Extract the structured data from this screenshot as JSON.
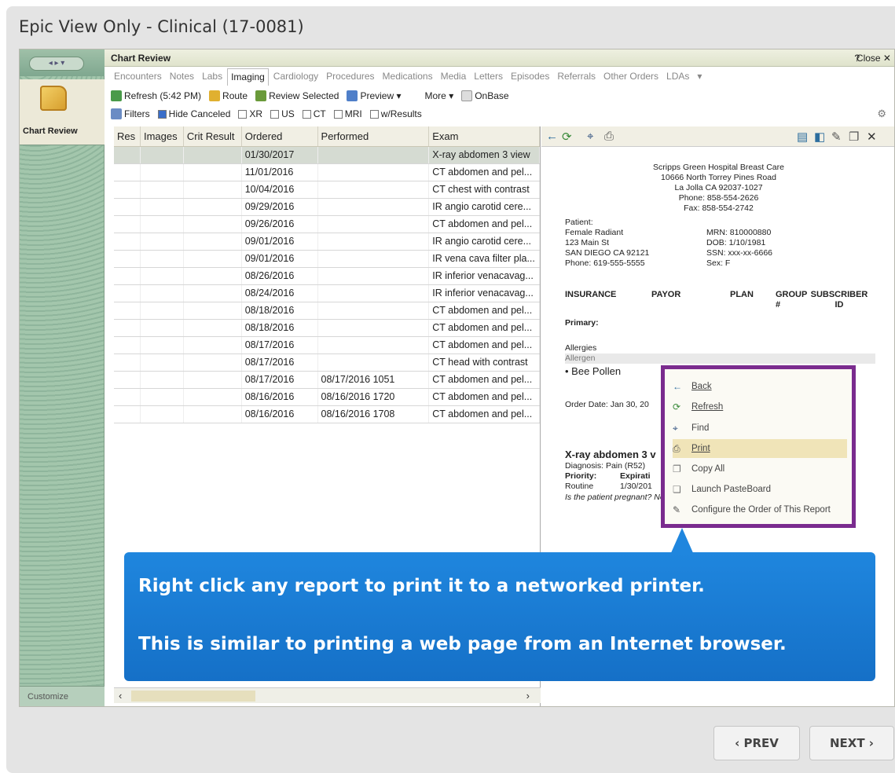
{
  "frame": {
    "title": "Epic View Only - Clinical (17-0081)"
  },
  "rail": {
    "nav_label": "◂ ▸ ▾",
    "activity_label": "Chart Review",
    "customize_label": "Customize"
  },
  "window": {
    "title": "Chart Review",
    "help": "?",
    "close": "Close ✕"
  },
  "tabs": [
    "Encounters",
    "Notes",
    "Labs",
    "Imaging",
    "Cardiology",
    "Procedures",
    "Medications",
    "Media",
    "Letters",
    "Episodes",
    "Referrals",
    "Other Orders",
    "LDAs",
    "▾"
  ],
  "toolbar1": {
    "refresh": "Refresh (5:42 PM)",
    "route": "Route",
    "review_selected": "Review Selected",
    "preview": "Preview ▾",
    "more": "More ▾",
    "onbase": "OnBase"
  },
  "toolbar2": {
    "filters": "Filters",
    "hide_canceled": "Hide Canceled",
    "xr": "XR",
    "us": "US",
    "ct": "CT",
    "mri": "MRI",
    "w_results": "w/Results"
  },
  "grid": {
    "headers": [
      "Res",
      "Images",
      "Crit Result",
      "Ordered",
      "Performed",
      "Exam"
    ],
    "rows": [
      {
        "ordered": "01/30/2017",
        "performed": "",
        "exam": "X-ray abdomen 3 view"
      },
      {
        "ordered": "11/01/2016",
        "performed": "",
        "exam": "CT abdomen and pel..."
      },
      {
        "ordered": "10/04/2016",
        "performed": "",
        "exam": "CT chest with contrast"
      },
      {
        "ordered": "09/29/2016",
        "performed": "",
        "exam": "IR angio carotid cere..."
      },
      {
        "ordered": "09/26/2016",
        "performed": "",
        "exam": "CT abdomen and pel..."
      },
      {
        "ordered": "09/01/2016",
        "performed": "",
        "exam": "IR angio carotid cere..."
      },
      {
        "ordered": "09/01/2016",
        "performed": "",
        "exam": "IR vena cava filter pla..."
      },
      {
        "ordered": "08/26/2016",
        "performed": "",
        "exam": "IR inferior venacavag..."
      },
      {
        "ordered": "08/24/2016",
        "performed": "",
        "exam": "IR inferior venacavag..."
      },
      {
        "ordered": "08/18/2016",
        "performed": "",
        "exam": "CT abdomen and pel..."
      },
      {
        "ordered": "08/18/2016",
        "performed": "",
        "exam": "CT abdomen and pel..."
      },
      {
        "ordered": "08/17/2016",
        "performed": "",
        "exam": "CT abdomen and pel..."
      },
      {
        "ordered": "08/17/2016",
        "performed": "",
        "exam": "CT head with contrast"
      },
      {
        "ordered": "08/17/2016",
        "performed": "08/17/2016 1051",
        "exam": "CT abdomen and pel..."
      },
      {
        "ordered": "08/16/2016",
        "performed": "08/16/2016 1720",
        "exam": "CT abdomen and pel..."
      },
      {
        "ordered": "08/16/2016",
        "performed": "08/16/2016 1708",
        "exam": "CT abdomen and pel..."
      }
    ]
  },
  "report": {
    "facility": [
      "Scripps Green Hospital Breast Care",
      "10666 North Torrey Pines Road",
      "La Jolla CA 92037-1027",
      "Phone: 858-554-2626",
      "Fax: 858-554-2742"
    ],
    "patient_label": "Patient:",
    "patient": [
      "Female Radiant",
      "123 Main St",
      "SAN DIEGO CA 92121",
      "Phone: 619-555-5555"
    ],
    "ids": [
      "MRN: 810000880",
      "DOB: 1/10/1981",
      "SSN: xxx-xx-6666",
      "Sex: F"
    ],
    "insurance_headers": [
      "INSURANCE",
      "PAYOR",
      "PLAN",
      "GROUP #",
      "SUBSCRIBER ID"
    ],
    "primary": "Primary:",
    "allergies": "Allergies",
    "allergen": "Allergen",
    "bee_pollen": "• Bee Pollen",
    "order_date": "Order Date: Jan 30, 20",
    "exam_title": "X-ray abdomen 3 v",
    "diagnosis": "Diagnosis: Pain (R52)",
    "priority": "Priority:",
    "expiration": "Expirati",
    "routine": "Routine",
    "date": "1/30/201",
    "pregnant": "Is the patient pregnant? No"
  },
  "context_menu": [
    "Back",
    "Refresh",
    "Find",
    "Print",
    "Copy All",
    "Launch PasteBoard",
    "Configure the Order of This Report"
  ],
  "callout": {
    "line1": "Right click any report to print it to a networked printer.",
    "line2": "This is similar to printing a web page from an Internet browser."
  },
  "nav": {
    "prev": "‹ PREV",
    "next": "NEXT ›"
  }
}
